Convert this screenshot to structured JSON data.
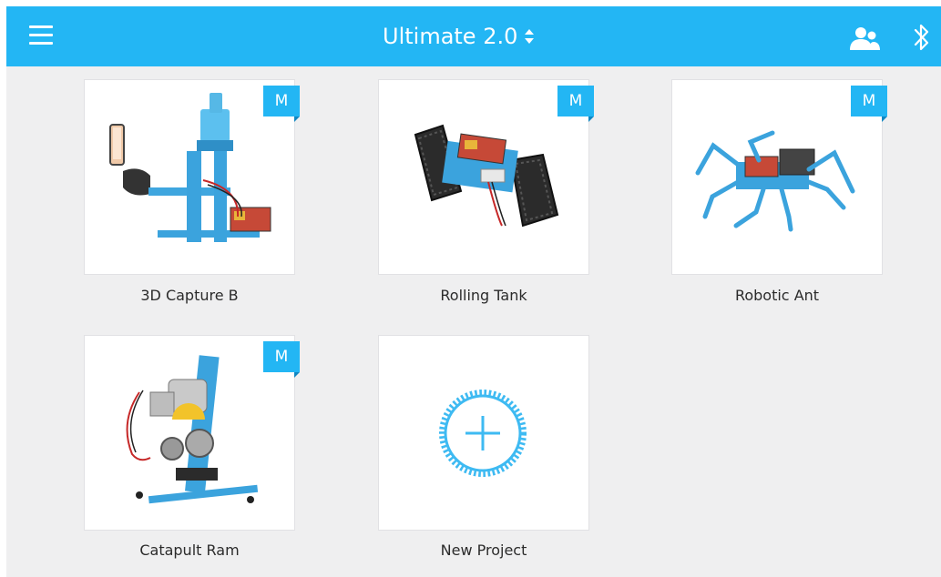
{
  "header": {
    "title": "Ultimate 2.0",
    "icons": [
      "menu-icon",
      "sort-arrows-icon",
      "user-group-icon",
      "bluetooth-icon"
    ],
    "bar_color": "#23b6f4"
  },
  "projects": [
    {
      "name": "3D Capture B",
      "badge": "M",
      "icon": "robot-3d-capture-image"
    },
    {
      "name": "Rolling Tank",
      "badge": "M",
      "icon": "robot-rolling-tank-image"
    },
    {
      "name": "Robotic Ant",
      "badge": "M",
      "icon": "robot-ant-image"
    },
    {
      "name": "Catapult Ram",
      "badge": "M",
      "icon": "robot-catapult-ram-image"
    },
    {
      "name": "New Project",
      "icon": "add-gear-icon"
    }
  ],
  "colors": {
    "accent": "#23b6f4",
    "background": "#efeff0",
    "card": "#ffffff",
    "text": "#2b2b2b"
  }
}
